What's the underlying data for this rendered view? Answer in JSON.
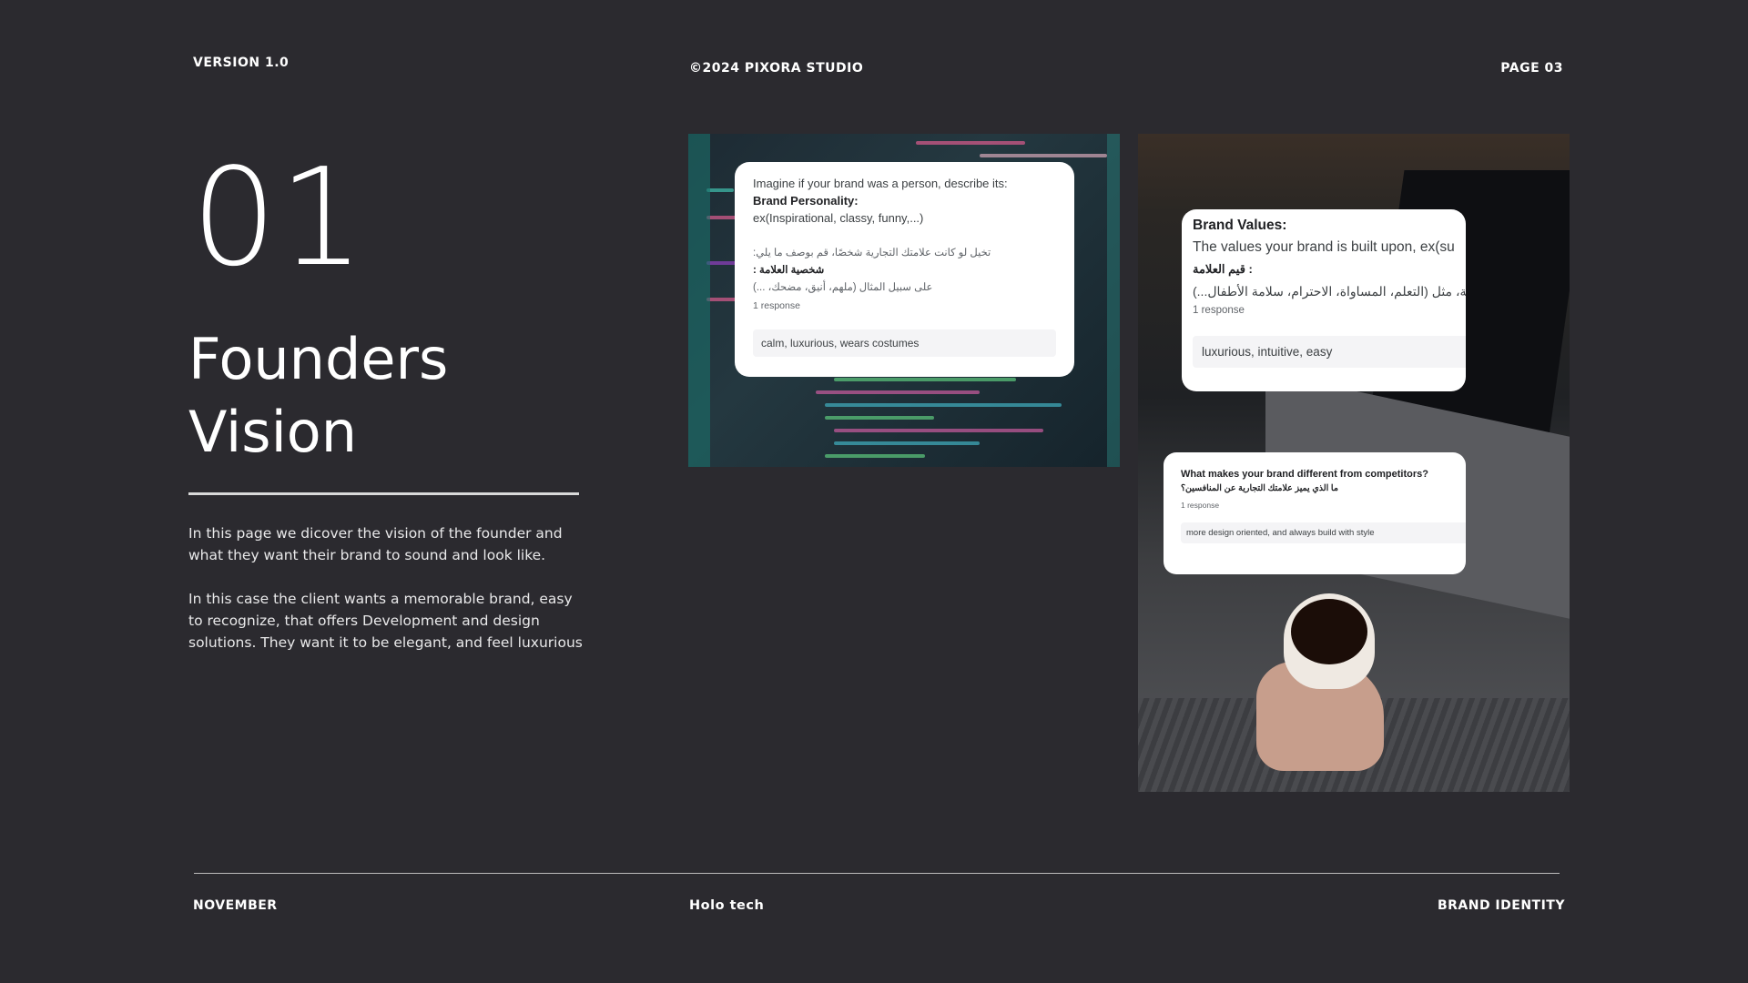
{
  "header": {
    "version": "VERSION 1.0",
    "copyright": "©2024 PIXORA STUDIO",
    "page": "PAGE 03"
  },
  "section": {
    "number": "01",
    "title": "Founders\nVision",
    "paragraphs": [
      "In this page we dicover the vision of the founder and what they want their brand to sound and look like.",
      "In this case the client wants a memorable brand, easy to recognize, that offers Development and design solutions. They want it to be elegant, and feel luxurious"
    ]
  },
  "cards": {
    "personality": {
      "intro": "Imagine if your brand was a person, describe its:",
      "label": "Brand Personality:",
      "example": "ex(Inspirational, classy, funny,...)",
      "ar_intro": "تخيل لو كانت علامتك التجارية شخصًا، قم بوصف ما يلي:",
      "ar_label": "شخصية العلامة :",
      "ar_example": "على سبيل المثال (ملهم، أنيق، مضحك، ...)",
      "responses": "1 response",
      "answer": "calm, luxurious, wears costumes"
    },
    "values": {
      "title": "Brand Values:",
      "desc": "The values your brand is built upon, ex(su",
      "ar_title": "قيم العلامة :",
      "ar_desc": "جارية، مثل (التعلم، المساواة، الاحترام، سلامة الأطفال...)",
      "responses": "1 response",
      "answer": "luxurious, intuitive, easy"
    },
    "different": {
      "title": "What makes your brand different from competitors?",
      "ar_title": "ما الذي يميز علامتك التجارية عن المنافسين؟",
      "responses": "1 response",
      "answer": "more design oriented, and always build with style"
    }
  },
  "images": {
    "code_photo": "code-screen-photo",
    "laptop_photo": "laptop-coffee-photo"
  },
  "footer": {
    "month": "NOVEMBER",
    "company": "Holo tech",
    "label": "BRAND IDENTITY"
  },
  "colors": {
    "background": "#2b2a2f",
    "text": "#ffffff",
    "card": "#ffffff"
  }
}
